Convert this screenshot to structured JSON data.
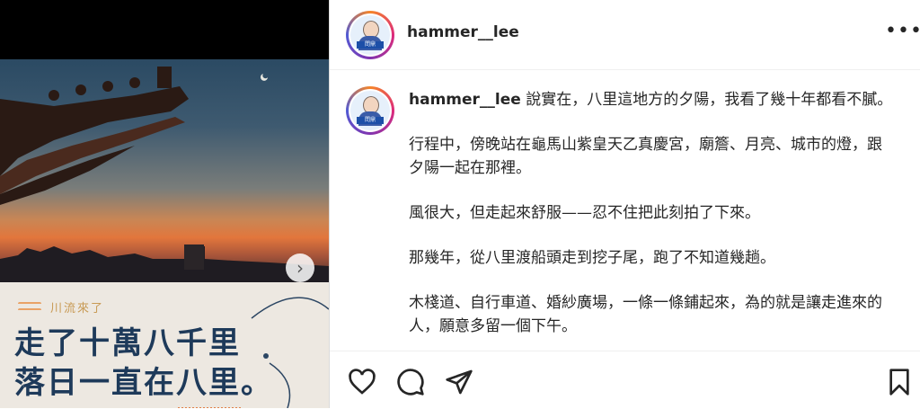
{
  "post": {
    "username": "hammer__lee",
    "avatar_text": "問鼎"
  },
  "image_card": {
    "brand": "川流來了",
    "headline_line1": "走了十萬八千里",
    "headline_line2": "落日一直在八里。"
  },
  "caption": {
    "username": "hammer__lee",
    "paragraphs": [
      "說實在，八里這地方的夕陽，我看了幾十年都看不膩。",
      "行程中，傍晚站在龜馬山紫皇天乙真慶宮，廟簷、月亮、城市的燈，跟夕陽一起在那裡。",
      "風很大，但走起來舒服——忍不住把此刻拍了下來。",
      "那幾年，從八里渡船頭走到挖子尾，跑了不知道幾趟。",
      "木棧道、自行車道、婚紗廣場，一條一條鋪起來，為的就是讓走進來的人，願意多留一個下午。"
    ]
  },
  "icons": {
    "like": "heart-icon",
    "comment": "comment-icon",
    "share": "send-icon",
    "save": "bookmark-icon",
    "next": "chevron-right-icon",
    "more": "more-options-icon"
  },
  "colors": {
    "headline": "#1e3a5a",
    "brand": "#c89a54",
    "card_bg": "#ede8e1"
  }
}
